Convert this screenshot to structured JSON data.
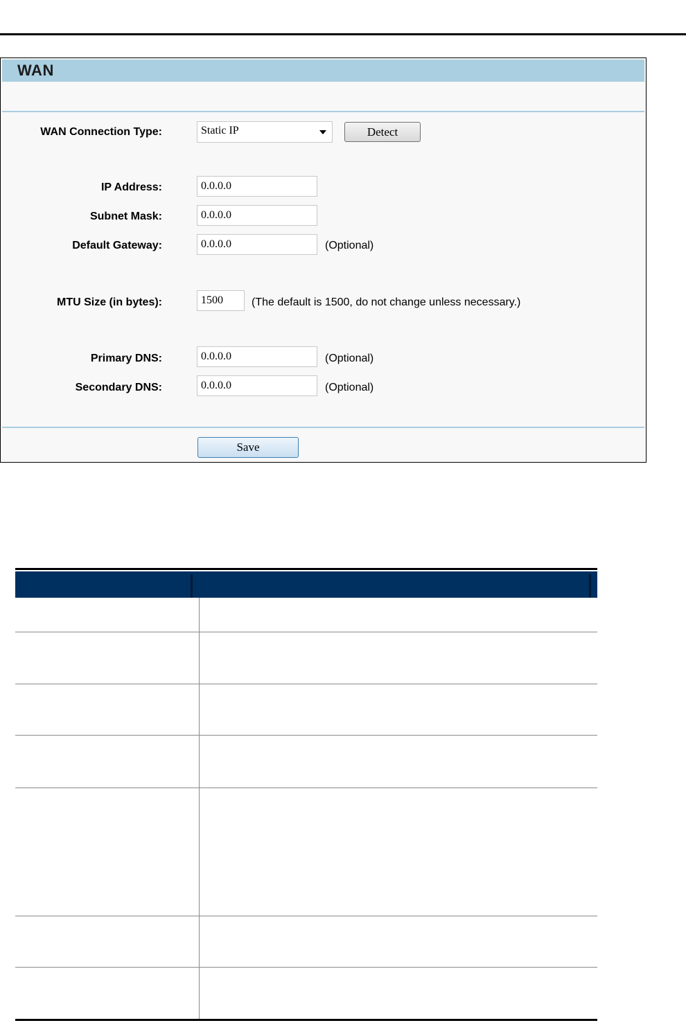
{
  "panel": {
    "title": "WAN"
  },
  "form": {
    "connection_type_label": "WAN Connection Type:",
    "connection_type_value": "Static IP",
    "detect_label": "Detect",
    "ip_address_label": "IP Address:",
    "ip_address_value": "0.0.0.0",
    "subnet_mask_label": "Subnet Mask:",
    "subnet_mask_value": "0.0.0.0",
    "default_gateway_label": "Default Gateway:",
    "default_gateway_value": "0.0.0.0",
    "optional_note": "(Optional)",
    "mtu_label": "MTU Size (in bytes):",
    "mtu_value": "1500",
    "mtu_note": "(The default is 1500, do not change unless necessary.)",
    "primary_dns_label": "Primary DNS:",
    "primary_dns_value": "0.0.0.0",
    "secondary_dns_label": "Secondary DNS:",
    "secondary_dns_value": "0.0.0.0",
    "save_label": "Save"
  },
  "colors": {
    "header_band": "#aacfe0",
    "table_header": "#003060"
  }
}
